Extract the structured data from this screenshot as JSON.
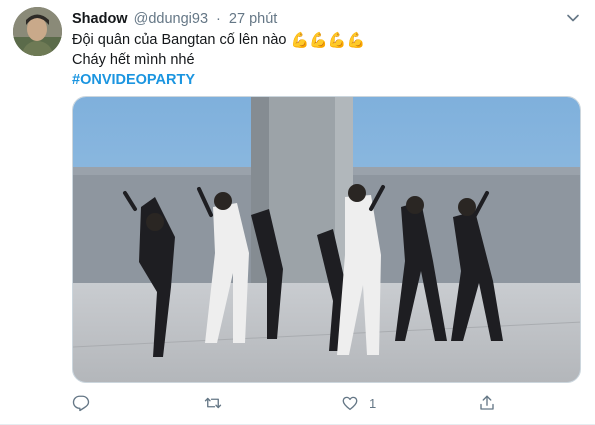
{
  "tweet": {
    "author_name": "Shadow",
    "author_handle": "@ddungi93",
    "separator": "·",
    "time": "27 phút",
    "line1": "Đội quân của Bangtan cố lên nào",
    "line1_emoji": "💪💪💪💪",
    "line2": "Cháy hết mình nhé",
    "hashtag": "#ONVIDEOPARTY",
    "media_icon": "image-photo-dancers",
    "actions": {
      "reply_icon": "reply-icon",
      "retweet_icon": "retweet-icon",
      "like_icon": "heart-icon",
      "like_count": "1",
      "share_icon": "share-icon"
    }
  },
  "colors": {
    "text": "#14171a",
    "muted": "#657786",
    "link": "#1b95e0",
    "border": "#e6ecf0"
  }
}
